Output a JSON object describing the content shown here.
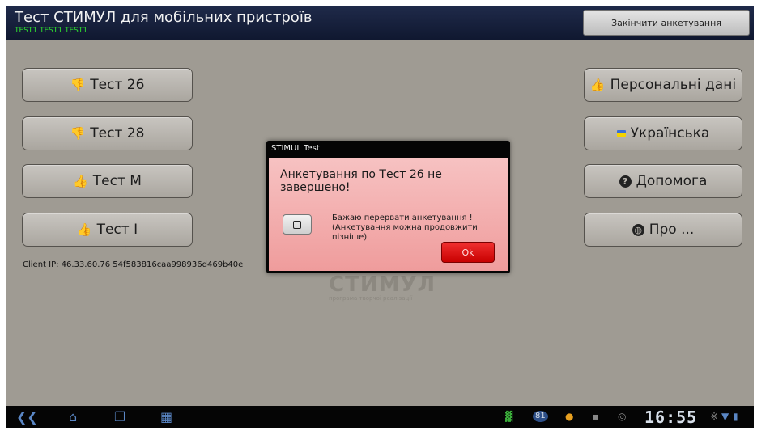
{
  "header": {
    "title": "Тест СТИМУЛ для мобільних пристроїв",
    "subtitle": "TEST1 TEST1 TEST1",
    "finish_label": "Закінчити анкетування"
  },
  "left_buttons": [
    {
      "label": "Тест 26",
      "icon": "thumbs-down-icon",
      "glyph": "👎"
    },
    {
      "label": "Тест 28",
      "icon": "thumbs-down-icon",
      "glyph": "👎"
    },
    {
      "label": "Тест М",
      "icon": "thumbs-up-icon",
      "glyph": "👍"
    },
    {
      "label": "Тест І",
      "icon": "thumbs-up-icon",
      "glyph": "👍"
    }
  ],
  "right_buttons": [
    {
      "label": "Персональні дані",
      "icon": "thumbs-up-icon"
    },
    {
      "label": "Українська",
      "icon": "ukraine-flag-icon"
    },
    {
      "label": "Допомога",
      "icon": "question-circle-icon"
    },
    {
      "label": "Про ...",
      "icon": "globe-icon"
    }
  ],
  "client_ip": "Client IP: 46.33.60.76 54f583816caa998936d469b40e",
  "logo": {
    "main": "СТИМУЛ",
    "sub": "програма творчої реалізації"
  },
  "dialog": {
    "title": "STIMUL Test",
    "message": "Анкетування по Тест 26 не завершено!",
    "checkbox_label": "Бажаю перервати анкетування ! (Анкетування можна продовжити пізніше)",
    "checkbox_checked": false,
    "ok_label": "Ok"
  },
  "status_bar": {
    "clock": "16:55",
    "badge": "81",
    "accent": "#5a86c4"
  },
  "colors": {
    "header_bg": "#1a2440",
    "subtitle": "#2ee02e",
    "background": "#9f9b93",
    "dialog_body": "#f3b0b0",
    "ok_button": "#e01010"
  }
}
